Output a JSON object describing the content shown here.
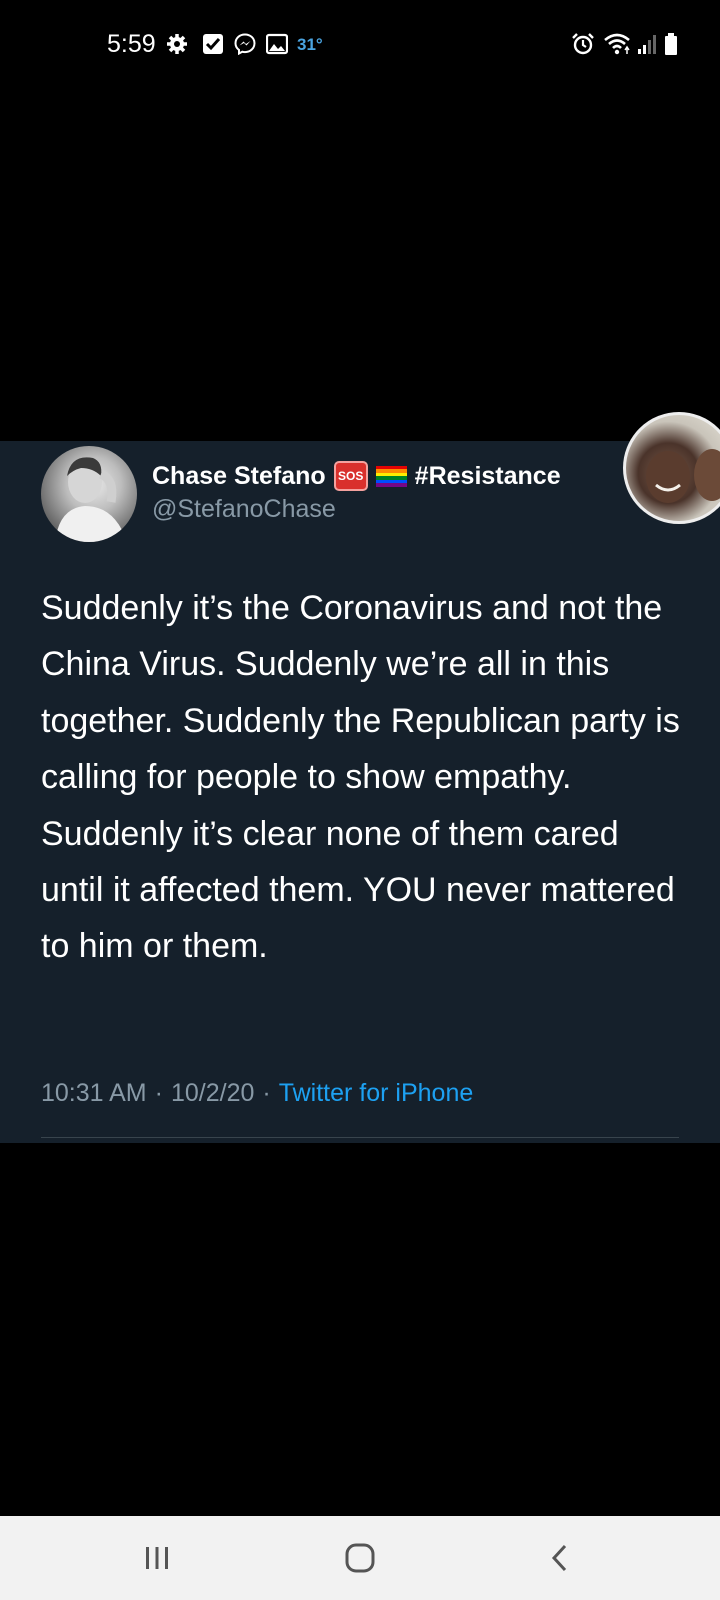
{
  "status_bar": {
    "time": "5:59",
    "temperature": "31°",
    "left_icons": [
      "gear-icon",
      "checkbox-icon",
      "messenger-icon",
      "image-icon"
    ],
    "right_icons": [
      "alarm-icon",
      "wifi-icon",
      "signal-icon",
      "battery-icon"
    ]
  },
  "tweet": {
    "display_name": "Chase Stefano",
    "badges": [
      "sos-icon",
      "rainbow-flag-icon"
    ],
    "hashtag": "#Resistance",
    "handle": "@StefanoChase",
    "text": "Suddenly it’s the Coronavirus and not the China Virus. Suddenly we’re all in this together. Suddenly the Republican party is calling for people to show empathy. Suddenly it’s clear none of them cared until it affected them. YOU never mattered to him or them.",
    "time": "10:31 AM",
    "separator": "·",
    "date": "10/2/20",
    "source": "Twitter for iPhone"
  },
  "colors": {
    "card_background": "#15202b",
    "secondary_text": "#8899a6",
    "link": "#1da1f2"
  },
  "nav_bar": {
    "buttons": [
      "recent-apps-icon",
      "home-icon",
      "back-icon"
    ]
  }
}
